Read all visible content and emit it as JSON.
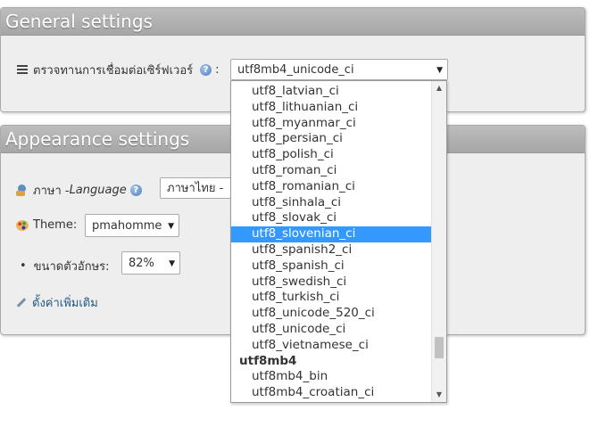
{
  "general": {
    "title": "General settings",
    "collation_label": "ตรวจทานการเชื่อมต่อเซิร์ฟเวอร์",
    "collation_colon": ":",
    "collation_value": "utf8mb4_unicode_ci",
    "help": "?",
    "arrow": "▼"
  },
  "appearance": {
    "title": "Appearance settings",
    "language_label": "ภาษา - ",
    "language_label_en": "Language",
    "language_value": "ภาษาไทย - ",
    "theme_label": "Theme:",
    "theme_value": "pmahomme",
    "fontsize_label": "ขนาดตัวอักษร:",
    "fontsize_value": "82%",
    "more_settings": "ตั้งค่าเพิ่มเติม",
    "help": "?",
    "arrow": "▼",
    "bullet": "•"
  },
  "dropdown": {
    "options": [
      {
        "text": "utf8_latvian_ci"
      },
      {
        "text": "utf8_lithuanian_ci"
      },
      {
        "text": "utf8_myanmar_ci"
      },
      {
        "text": "utf8_persian_ci"
      },
      {
        "text": "utf8_polish_ci"
      },
      {
        "text": "utf8_roman_ci"
      },
      {
        "text": "utf8_romanian_ci"
      },
      {
        "text": "utf8_sinhala_ci"
      },
      {
        "text": "utf8_slovak_ci"
      },
      {
        "text": "utf8_slovenian_ci",
        "selected": true
      },
      {
        "text": "utf8_spanish2_ci"
      },
      {
        "text": "utf8_spanish_ci"
      },
      {
        "text": "utf8_swedish_ci"
      },
      {
        "text": "utf8_turkish_ci"
      },
      {
        "text": "utf8_unicode_520_ci"
      },
      {
        "text": "utf8_unicode_ci"
      },
      {
        "text": "utf8_vietnamese_ci"
      },
      {
        "text": "utf8mb4",
        "group": true
      },
      {
        "text": "utf8mb4_bin"
      },
      {
        "text": "utf8mb4_croatian_ci"
      }
    ],
    "scroll_up": "▲",
    "scroll_down": "▼"
  }
}
